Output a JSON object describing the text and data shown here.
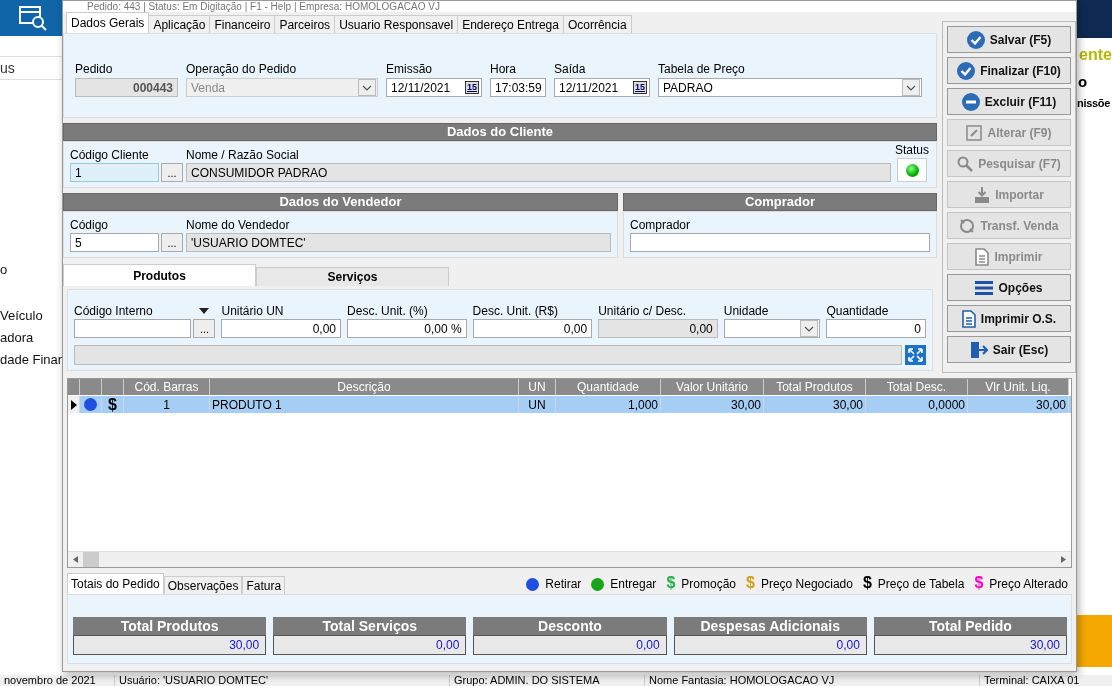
{
  "background": {
    "left_texts": [
      "us",
      "o",
      "Veículo",
      "adora",
      "dade Finar"
    ],
    "right_texts": [
      "ente",
      "o",
      "nissõe"
    ],
    "status_bar": [
      "novembro  de  2021",
      "Usuário: 'USUARIO DOMTEC'",
      "Grupo: ADMIN. DO SISTEMA",
      "Nome Fantasia: HOMOLOGACAO VJ",
      "Terminal: CAIXA 01"
    ]
  },
  "window": {
    "title": "Pedido: 443 | Status: Em Digitação | F1 - Help | Empresa: HOMOLOGACAO VJ"
  },
  "tabs": [
    {
      "label": "Dados Gerais",
      "selected": true
    },
    {
      "label": "Aplicação",
      "selected": false
    },
    {
      "label": "Financeiro",
      "selected": false
    },
    {
      "label": "Parceiros",
      "selected": false
    },
    {
      "label": "Usuario Responsavel",
      "selected": false
    },
    {
      "label": "Endereço Entrega",
      "selected": false
    },
    {
      "label": "Ocorrência",
      "selected": false
    }
  ],
  "header_fields": [
    {
      "kind": "number",
      "label": "Pedido",
      "value": "000443"
    },
    {
      "kind": "combo",
      "label": "Operação do Pedido",
      "value": "Venda",
      "disabled": true
    },
    {
      "kind": "date",
      "label": "Emissão",
      "value": "12/11/2021",
      "icon_text": "15"
    },
    {
      "kind": "text",
      "label": "Hora",
      "value": "17:03:59"
    },
    {
      "kind": "date",
      "label": "Saída",
      "value": "12/11/2021",
      "icon_text": "15"
    },
    {
      "kind": "combo",
      "label": "Tabela de Preço",
      "value": "PADRAO",
      "disabled": false
    }
  ],
  "client": {
    "title": "Dados do Cliente",
    "code_label": "Código Cliente",
    "code": "1",
    "lookup": "...",
    "name_label": "Nome / Razão Social",
    "name": "CONSUMIDOR PADRAO",
    "status_label": "Status",
    "status_on": true
  },
  "seller": {
    "title": "Dados do Vendedor",
    "code_label": "Código",
    "code": "5",
    "lookup": "...",
    "name_label": "Nome do Vendedor",
    "name": "'USUARIO DOMTEC'"
  },
  "buyer": {
    "title": "Comprador",
    "label": "Comprador"
  },
  "item_tabs": [
    {
      "label": "Produtos",
      "selected": true
    },
    {
      "label": "Serviços",
      "selected": false
    }
  ],
  "item_fields": [
    {
      "kind": "lookup",
      "label": "Código Interno",
      "button": "..."
    },
    {
      "kind": "text",
      "label": "Unitário UN",
      "value": "0,00",
      "disabled": false
    },
    {
      "kind": "text",
      "label": "Desc. Unit. (%)",
      "value": "0,00 %",
      "disabled": false
    },
    {
      "kind": "text",
      "label": "Desc. Unit. (R$)",
      "value": "0,00",
      "disabled": false
    },
    {
      "kind": "text",
      "label": "Unitário c/ Desc.",
      "value": "0,00",
      "disabled": true
    },
    {
      "kind": "combo",
      "label": "Unidade"
    },
    {
      "kind": "text",
      "label": "Quantidade",
      "value": "0",
      "disabled": false
    }
  ],
  "grid": {
    "columns": [
      "Cód. Barras",
      "Descrição",
      "UN",
      "Quantidade",
      "Valor Unitário",
      "Total Produtos",
      "Total Desc.",
      "Vlr Unit. Liq."
    ],
    "rows": [
      {
        "selected": true,
        "pickup": true,
        "price_mark": "$",
        "color": "#000000",
        "cells": [
          "1",
          "PRODUTO 1",
          "UN",
          "1,000",
          "30,00",
          "30,00",
          "0,0000",
          "30,00"
        ]
      }
    ]
  },
  "bottom_tabs": [
    {
      "label": "Totais do Pedido",
      "selected": true
    },
    {
      "label": "Observações",
      "selected": false
    },
    {
      "label": "Fatura",
      "selected": false
    }
  ],
  "legend": [
    {
      "kind": "dot",
      "label": "Retirar",
      "color": "#1f4fe0"
    },
    {
      "kind": "dot",
      "label": "Entregar",
      "color": "#17a51c"
    },
    {
      "kind": "dollar",
      "symbol": "$",
      "label": "Promoção",
      "color": "#22b04a"
    },
    {
      "kind": "dollar",
      "symbol": "$",
      "label": "Preço Negociado",
      "color": "#d4a017"
    },
    {
      "kind": "dollar",
      "symbol": "$",
      "label": "Preço de Tabela",
      "color": "#000000"
    },
    {
      "kind": "dollar",
      "symbol": "$",
      "label": "Preço Alterado",
      "color": "#ff00cc"
    }
  ],
  "totals": [
    {
      "label": "Total Produtos",
      "value": "30,00"
    },
    {
      "label": "Total Serviços",
      "value": "0,00"
    },
    {
      "label": "Desconto",
      "value": "0,00"
    },
    {
      "label": "Despesas Adicionais",
      "value": "0,00"
    },
    {
      "label": "Total Pedido",
      "value": "30,00"
    }
  ],
  "buttons": [
    {
      "label": "Salvar (F5)",
      "kind": "check",
      "disabled": false
    },
    {
      "label": "Finalizar (F10)",
      "kind": "check",
      "disabled": false
    },
    {
      "label": "Excluir (F11)",
      "kind": "minus",
      "disabled": false
    },
    {
      "label": "Alterar (F9)",
      "kind": "edit",
      "disabled": true
    },
    {
      "label": "Pesquisar (F7)",
      "kind": "search",
      "disabled": true
    },
    {
      "label": "Importar",
      "kind": "import",
      "disabled": true
    },
    {
      "label": "Transf. Venda",
      "kind": "transfer",
      "disabled": true
    },
    {
      "label": "Imprimir",
      "kind": "doc",
      "disabled": true
    },
    {
      "label": "Opções",
      "kind": "menu",
      "disabled": false
    },
    {
      "label": "Imprimir O.S.",
      "kind": "doc",
      "disabled": false
    },
    {
      "label": "Sair (Esc)",
      "kind": "exit",
      "disabled": false
    }
  ]
}
